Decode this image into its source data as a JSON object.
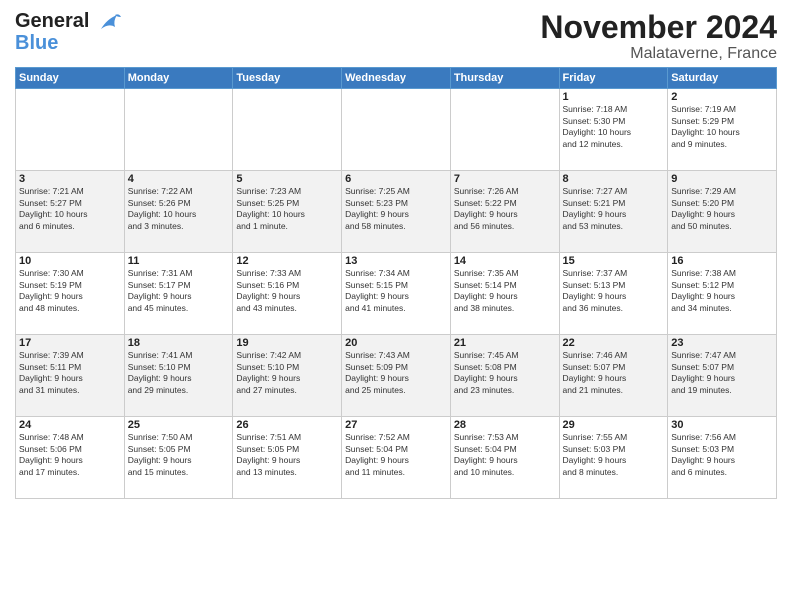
{
  "header": {
    "logo_line1": "General",
    "logo_line2": "Blue",
    "month": "November 2024",
    "location": "Malataverne, France"
  },
  "weekdays": [
    "Sunday",
    "Monday",
    "Tuesday",
    "Wednesday",
    "Thursday",
    "Friday",
    "Saturday"
  ],
  "weeks": [
    [
      {
        "day": "",
        "info": ""
      },
      {
        "day": "",
        "info": ""
      },
      {
        "day": "",
        "info": ""
      },
      {
        "day": "",
        "info": ""
      },
      {
        "day": "",
        "info": ""
      },
      {
        "day": "1",
        "info": "Sunrise: 7:18 AM\nSunset: 5:30 PM\nDaylight: 10 hours\nand 12 minutes."
      },
      {
        "day": "2",
        "info": "Sunrise: 7:19 AM\nSunset: 5:29 PM\nDaylight: 10 hours\nand 9 minutes."
      }
    ],
    [
      {
        "day": "3",
        "info": "Sunrise: 7:21 AM\nSunset: 5:27 PM\nDaylight: 10 hours\nand 6 minutes."
      },
      {
        "day": "4",
        "info": "Sunrise: 7:22 AM\nSunset: 5:26 PM\nDaylight: 10 hours\nand 3 minutes."
      },
      {
        "day": "5",
        "info": "Sunrise: 7:23 AM\nSunset: 5:25 PM\nDaylight: 10 hours\nand 1 minute."
      },
      {
        "day": "6",
        "info": "Sunrise: 7:25 AM\nSunset: 5:23 PM\nDaylight: 9 hours\nand 58 minutes."
      },
      {
        "day": "7",
        "info": "Sunrise: 7:26 AM\nSunset: 5:22 PM\nDaylight: 9 hours\nand 56 minutes."
      },
      {
        "day": "8",
        "info": "Sunrise: 7:27 AM\nSunset: 5:21 PM\nDaylight: 9 hours\nand 53 minutes."
      },
      {
        "day": "9",
        "info": "Sunrise: 7:29 AM\nSunset: 5:20 PM\nDaylight: 9 hours\nand 50 minutes."
      }
    ],
    [
      {
        "day": "10",
        "info": "Sunrise: 7:30 AM\nSunset: 5:19 PM\nDaylight: 9 hours\nand 48 minutes."
      },
      {
        "day": "11",
        "info": "Sunrise: 7:31 AM\nSunset: 5:17 PM\nDaylight: 9 hours\nand 45 minutes."
      },
      {
        "day": "12",
        "info": "Sunrise: 7:33 AM\nSunset: 5:16 PM\nDaylight: 9 hours\nand 43 minutes."
      },
      {
        "day": "13",
        "info": "Sunrise: 7:34 AM\nSunset: 5:15 PM\nDaylight: 9 hours\nand 41 minutes."
      },
      {
        "day": "14",
        "info": "Sunrise: 7:35 AM\nSunset: 5:14 PM\nDaylight: 9 hours\nand 38 minutes."
      },
      {
        "day": "15",
        "info": "Sunrise: 7:37 AM\nSunset: 5:13 PM\nDaylight: 9 hours\nand 36 minutes."
      },
      {
        "day": "16",
        "info": "Sunrise: 7:38 AM\nSunset: 5:12 PM\nDaylight: 9 hours\nand 34 minutes."
      }
    ],
    [
      {
        "day": "17",
        "info": "Sunrise: 7:39 AM\nSunset: 5:11 PM\nDaylight: 9 hours\nand 31 minutes."
      },
      {
        "day": "18",
        "info": "Sunrise: 7:41 AM\nSunset: 5:10 PM\nDaylight: 9 hours\nand 29 minutes."
      },
      {
        "day": "19",
        "info": "Sunrise: 7:42 AM\nSunset: 5:10 PM\nDaylight: 9 hours\nand 27 minutes."
      },
      {
        "day": "20",
        "info": "Sunrise: 7:43 AM\nSunset: 5:09 PM\nDaylight: 9 hours\nand 25 minutes."
      },
      {
        "day": "21",
        "info": "Sunrise: 7:45 AM\nSunset: 5:08 PM\nDaylight: 9 hours\nand 23 minutes."
      },
      {
        "day": "22",
        "info": "Sunrise: 7:46 AM\nSunset: 5:07 PM\nDaylight: 9 hours\nand 21 minutes."
      },
      {
        "day": "23",
        "info": "Sunrise: 7:47 AM\nSunset: 5:07 PM\nDaylight: 9 hours\nand 19 minutes."
      }
    ],
    [
      {
        "day": "24",
        "info": "Sunrise: 7:48 AM\nSunset: 5:06 PM\nDaylight: 9 hours\nand 17 minutes."
      },
      {
        "day": "25",
        "info": "Sunrise: 7:50 AM\nSunset: 5:05 PM\nDaylight: 9 hours\nand 15 minutes."
      },
      {
        "day": "26",
        "info": "Sunrise: 7:51 AM\nSunset: 5:05 PM\nDaylight: 9 hours\nand 13 minutes."
      },
      {
        "day": "27",
        "info": "Sunrise: 7:52 AM\nSunset: 5:04 PM\nDaylight: 9 hours\nand 11 minutes."
      },
      {
        "day": "28",
        "info": "Sunrise: 7:53 AM\nSunset: 5:04 PM\nDaylight: 9 hours\nand 10 minutes."
      },
      {
        "day": "29",
        "info": "Sunrise: 7:55 AM\nSunset: 5:03 PM\nDaylight: 9 hours\nand 8 minutes."
      },
      {
        "day": "30",
        "info": "Sunrise: 7:56 AM\nSunset: 5:03 PM\nDaylight: 9 hours\nand 6 minutes."
      }
    ]
  ]
}
